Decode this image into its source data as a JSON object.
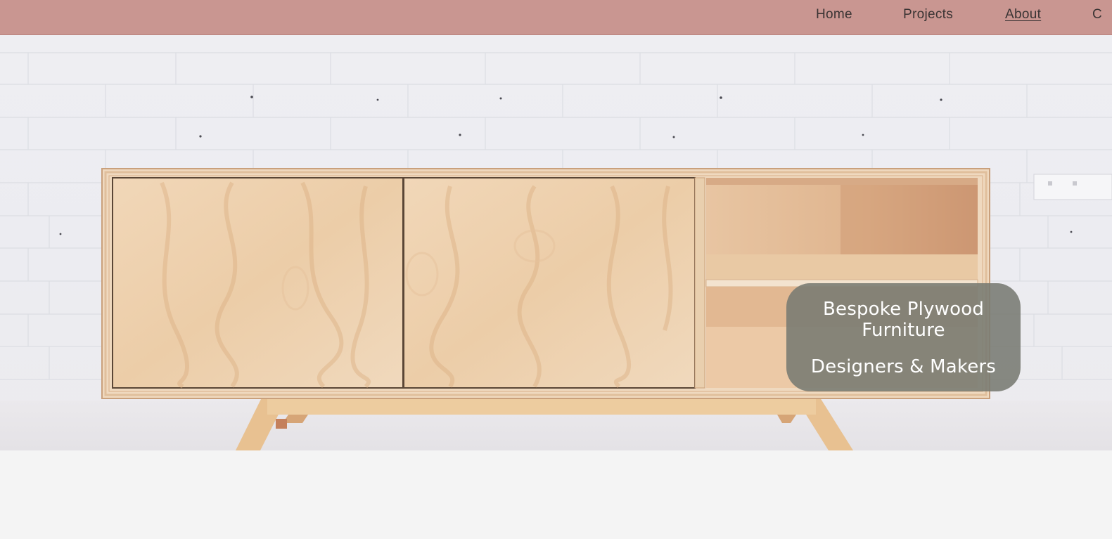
{
  "nav": {
    "items": [
      {
        "label": "Home",
        "active": false
      },
      {
        "label": "Projects",
        "active": false
      },
      {
        "label": "About",
        "active": true
      },
      {
        "label": "C",
        "active": false
      }
    ]
  },
  "hero": {
    "image_subject": "plywood-sideboard-photo",
    "tagline": {
      "title": "Bespoke Plywood Furniture",
      "subtitle": "Designers & Makers"
    }
  },
  "colors": {
    "nav_background": "#c99691",
    "nav_text": "#3a3434",
    "card_background": "#787a72",
    "page_background": "#f4f4f4"
  }
}
